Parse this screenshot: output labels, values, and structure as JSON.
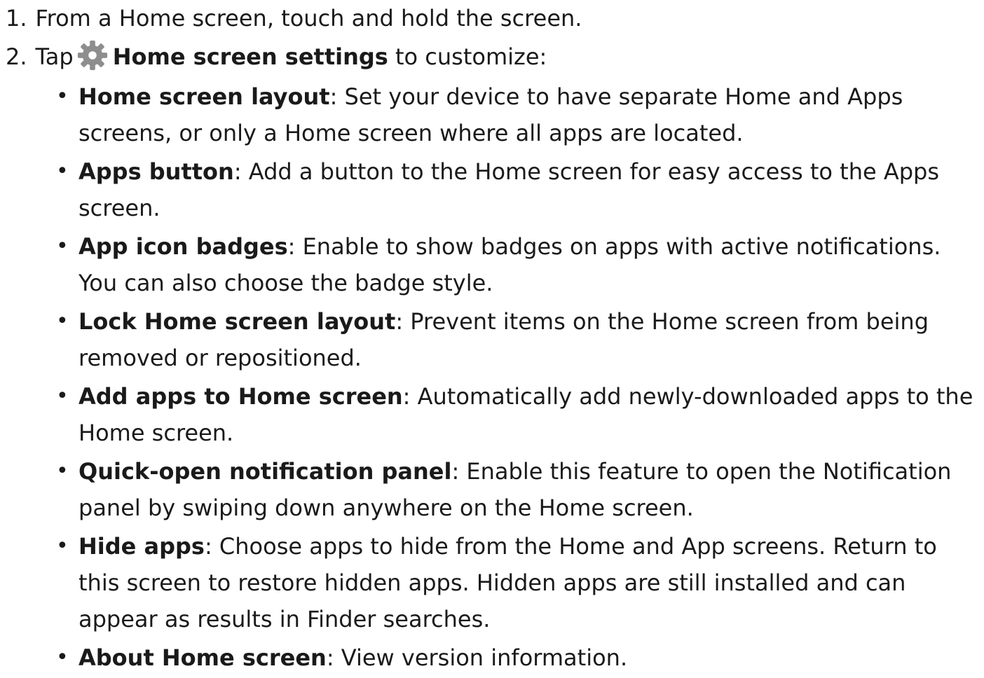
{
  "steps": [
    {
      "number": "1.",
      "text": "From a Home screen, touch and hold the screen."
    },
    {
      "number": "2.",
      "prefix": "Tap",
      "icon": "gear-icon",
      "link": "Home screen settings",
      "suffix": "to customize:"
    }
  ],
  "colors": {
    "text": "#1a1a1a",
    "icon": "#8e8e8e"
  },
  "settings": [
    {
      "term": "Home screen layout",
      "description": "Set your device to have separate Home and Apps screens, or only a Home screen where all apps are located."
    },
    {
      "term": "Apps button",
      "description": "Add a button to the Home screen for easy access to the Apps screen."
    },
    {
      "term": "App icon badges",
      "description": "Enable to show badges on apps with active notifications. You can also choose the badge style."
    },
    {
      "term": "Lock Home screen layout",
      "description": "Prevent items on the Home screen from being removed or repositioned."
    },
    {
      "term": "Add apps to Home screen",
      "description": "Automatically add newly-downloaded apps to the Home screen."
    },
    {
      "term": "Quick-open notification panel",
      "description": "Enable this feature to open the Notification panel by swiping down anywhere on the Home screen."
    },
    {
      "term": "Hide apps",
      "description": "Choose apps to hide from the Home and App screens. Return to this screen to restore hidden apps. Hidden apps are still installed and can appear as results in Finder searches."
    },
    {
      "term": "About Home screen",
      "description": "View version information."
    }
  ]
}
